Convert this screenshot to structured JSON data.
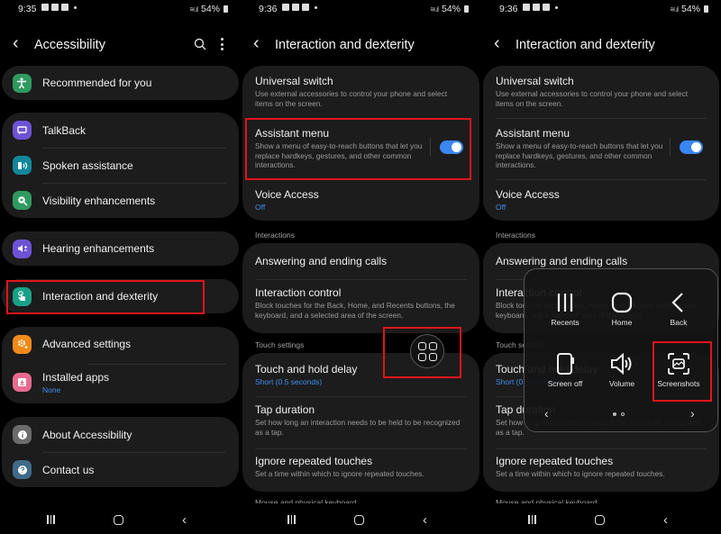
{
  "screen1": {
    "status": {
      "time": "9:35",
      "battery": "54%"
    },
    "title": "Accessibility",
    "groups": [
      {
        "items": [
          {
            "label": "Recommended for you",
            "icon": "accessibility-person-icon",
            "color": "#2f9a5f"
          }
        ]
      },
      {
        "items": [
          {
            "label": "TalkBack",
            "icon": "talkback-icon",
            "color": "#6e52d6"
          },
          {
            "label": "Spoken assistance",
            "icon": "spoken-assistance-icon",
            "color": "#12879a"
          },
          {
            "label": "Visibility enhancements",
            "icon": "magnifier-icon",
            "color": "#2f9a5f"
          }
        ]
      },
      {
        "items": [
          {
            "label": "Hearing enhancements",
            "icon": "hearing-icon",
            "color": "#6e52d6"
          }
        ]
      },
      {
        "items": [
          {
            "label": "Interaction and dexterity",
            "icon": "hand-touch-icon",
            "color": "#18a088"
          }
        ]
      },
      {
        "items": [
          {
            "label": "Advanced settings",
            "icon": "gear-plus-icon",
            "color": "#f08a18"
          },
          {
            "label": "Installed apps",
            "sub": "None",
            "icon": "download-icon",
            "color": "#e86a90"
          }
        ]
      },
      {
        "items": [
          {
            "label": "About Accessibility",
            "icon": "info-icon",
            "color": "#6b6b6b"
          },
          {
            "label": "Contact us",
            "icon": "help-icon",
            "color": "#3f6a88"
          }
        ]
      }
    ]
  },
  "screen2": {
    "status": {
      "time": "9:36",
      "battery": "54%"
    },
    "title": "Interaction and dexterity",
    "items": {
      "universal_switch": {
        "label": "Universal switch",
        "desc": "Use external accessories to control your phone and select items on the screen."
      },
      "assistant_menu": {
        "label": "Assistant menu",
        "desc": "Show a menu of easy-to-reach buttons that let you replace hardkeys, gestures, and other common interactions.",
        "enabled": true
      },
      "voice_access": {
        "label": "Voice Access",
        "value": "Off"
      },
      "section_interactions": "Interactions",
      "answering_calls": {
        "label": "Answering and ending calls"
      },
      "interaction_control": {
        "label": "Interaction control",
        "desc": "Block touches for the Back, Home, and Recents buttons, the keyboard, and a selected area of the screen."
      },
      "section_touch": "Touch settings",
      "touch_hold": {
        "label": "Touch and hold delay",
        "value": "Short (0.5 seconds)"
      },
      "tap_duration": {
        "label": "Tap duration",
        "desc": "Set how long an interaction needs to be held to be recognized as a tap."
      },
      "ignore_repeated": {
        "label": "Ignore repeated touches",
        "desc": "Set a time within which to ignore repeated touches."
      },
      "section_mouse": "Mouse and physical keyboard"
    }
  },
  "screen3": {
    "status": {
      "time": "9:36",
      "battery": "54%"
    },
    "assistant_menu_popup": {
      "items": [
        {
          "label": "Recents",
          "icon": "recents-icon"
        },
        {
          "label": "Home",
          "icon": "home-icon"
        },
        {
          "label": "Back",
          "icon": "back-icon"
        },
        {
          "label": "Screen off",
          "icon": "screen-off-icon"
        },
        {
          "label": "Volume",
          "icon": "volume-icon"
        },
        {
          "label": "Screenshots",
          "icon": "screenshot-icon"
        }
      ],
      "page": 1,
      "pages": 2
    }
  },
  "colors": {
    "accent": "#3a86f5",
    "highlight": "#e0151b",
    "card": "#1c1c1c"
  }
}
